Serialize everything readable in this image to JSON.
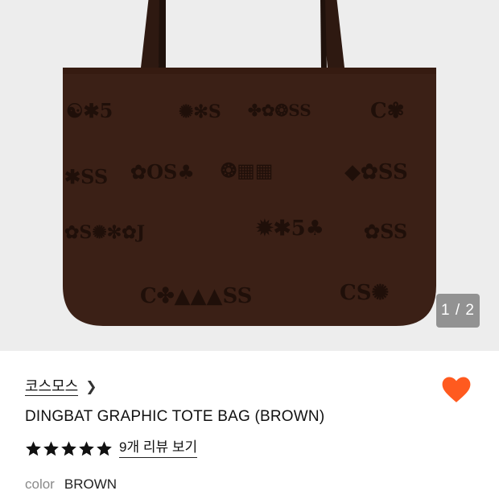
{
  "gallery": {
    "page_indicator": "1 / 2",
    "product_color_hex": "#3a1f14"
  },
  "product": {
    "brand": "코스모스",
    "title": "DINGBAT GRAPHIC TOTE BAG (BROWN)",
    "rating_stars": 5,
    "review_link": "9개 리뷰 보기",
    "color_label": "color",
    "color_value": "BROWN"
  },
  "icons": {
    "chevron": "chevron-right-icon",
    "wishlist": "heart-icon",
    "star": "star-icon"
  },
  "colors": {
    "heart": "#ff5a1f",
    "star": "#111111",
    "gallery_bg": "#ededed"
  }
}
